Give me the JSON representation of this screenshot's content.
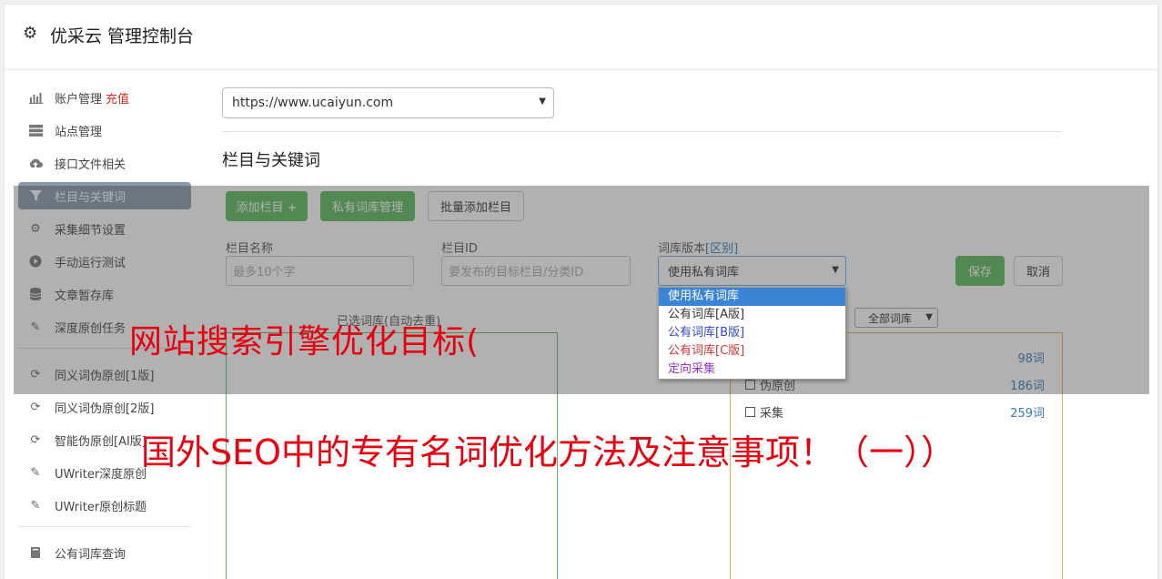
{
  "app": {
    "title": "优采云 管理控制台",
    "icon": "gear-icon"
  },
  "sidebar": {
    "items": [
      {
        "label": "账户管理",
        "extra": "充值",
        "icon": "bar-chart-icon"
      },
      {
        "label": "站点管理",
        "icon": "server-icon"
      },
      {
        "label": "接口文件相关",
        "icon": "cloud-upload-icon"
      },
      {
        "label": "栏目与关键词",
        "icon": "filter-icon",
        "active": true
      },
      {
        "label": "采集细节设置",
        "icon": "cogs-icon"
      },
      {
        "label": "手动运行测试",
        "icon": "play-circle-icon"
      },
      {
        "label": "文章暂存库",
        "icon": "database-icon"
      },
      {
        "label": "深度原创任务",
        "icon": "edit-icon"
      },
      {
        "label": "同义词伪原创[1版]",
        "icon": "refresh-icon"
      },
      {
        "label": "同义词伪原创[2版]",
        "icon": "refresh-icon"
      },
      {
        "label": "智能伪原创[AI版]",
        "icon": "refresh-icon"
      },
      {
        "label": "UWriter深度原创",
        "icon": "edit-icon"
      },
      {
        "label": "UWriter原创标题",
        "icon": "edit-icon"
      },
      {
        "label": "公有词库查询",
        "icon": "book-icon"
      }
    ]
  },
  "main": {
    "site_select": "https://www.ucaiyun.com",
    "section_title": "栏目与关键词",
    "buttons": {
      "add_column": "添加栏目 +",
      "private_lib": "私有词库管理",
      "batch_add": "批量添加栏目"
    },
    "form": {
      "name_label": "栏目名称",
      "name_placeholder": "最多10个字",
      "id_label": "栏目ID",
      "id_placeholder": "要发布的目标栏目/分类ID",
      "version_label": "词库版本",
      "version_link": "[区别]",
      "version_value": "使用私有词库",
      "save": "保存",
      "cancel": "取消"
    },
    "dropdown_options": [
      {
        "label": "使用私有词库",
        "color": "#ffffff",
        "selected": true
      },
      {
        "label": "公有词库[A版]",
        "color": "#333333"
      },
      {
        "label": "公有词库[B版]",
        "color": "#3344cc"
      },
      {
        "label": "公有词库[C版]",
        "color": "#cc3333"
      },
      {
        "label": "定向采集",
        "color": "#9933cc"
      }
    ],
    "selected_panel_label": "已选词库(自动去重)",
    "lib_filter": "全部词库",
    "stats": [
      {
        "label": "",
        "count": "98词"
      },
      {
        "label": "伪原创",
        "count": "186词"
      },
      {
        "label": "采集",
        "count": "259词"
      }
    ]
  },
  "overlay_text": {
    "line1": "网站搜索引擎优化目标(",
    "line2": "国外SEO中的专有名词优化方法及注意事项！（一））"
  },
  "colors": {
    "green": "#5cb85c",
    "link": "#337ab7",
    "red": "#e8000f"
  }
}
